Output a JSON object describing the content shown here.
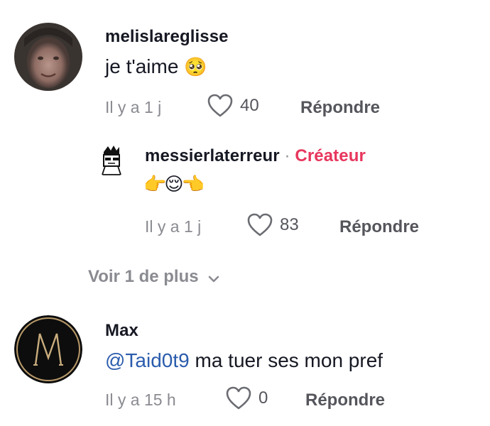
{
  "comments": [
    {
      "username": "melislareglisse",
      "text": "je t'aime",
      "emoji": "🥺",
      "time": "Il y a 1 j",
      "likes": "40",
      "reply_label": "Répondre"
    },
    {
      "username": "messierlaterreur",
      "separator": "·",
      "badge": "Créateur",
      "emoji_text": "👉😌👈",
      "time": "Il y a 1 j",
      "likes": "83",
      "reply_label": "Répondre"
    },
    {
      "username": "Max",
      "mention": "@Taid0t9",
      "text": "ma tuer ses mon pref",
      "time": "Il y a 15 h",
      "likes": "0",
      "reply_label": "Répondre"
    }
  ],
  "view_more": {
    "label": "Voir 1 de plus",
    "icon": "chevron-down-icon"
  },
  "icons": {
    "like": "heart-outline-icon"
  },
  "colors": {
    "creator_badge": "#e8365d",
    "mention": "#2b5cad",
    "meta_gray": "#8a8b91"
  }
}
